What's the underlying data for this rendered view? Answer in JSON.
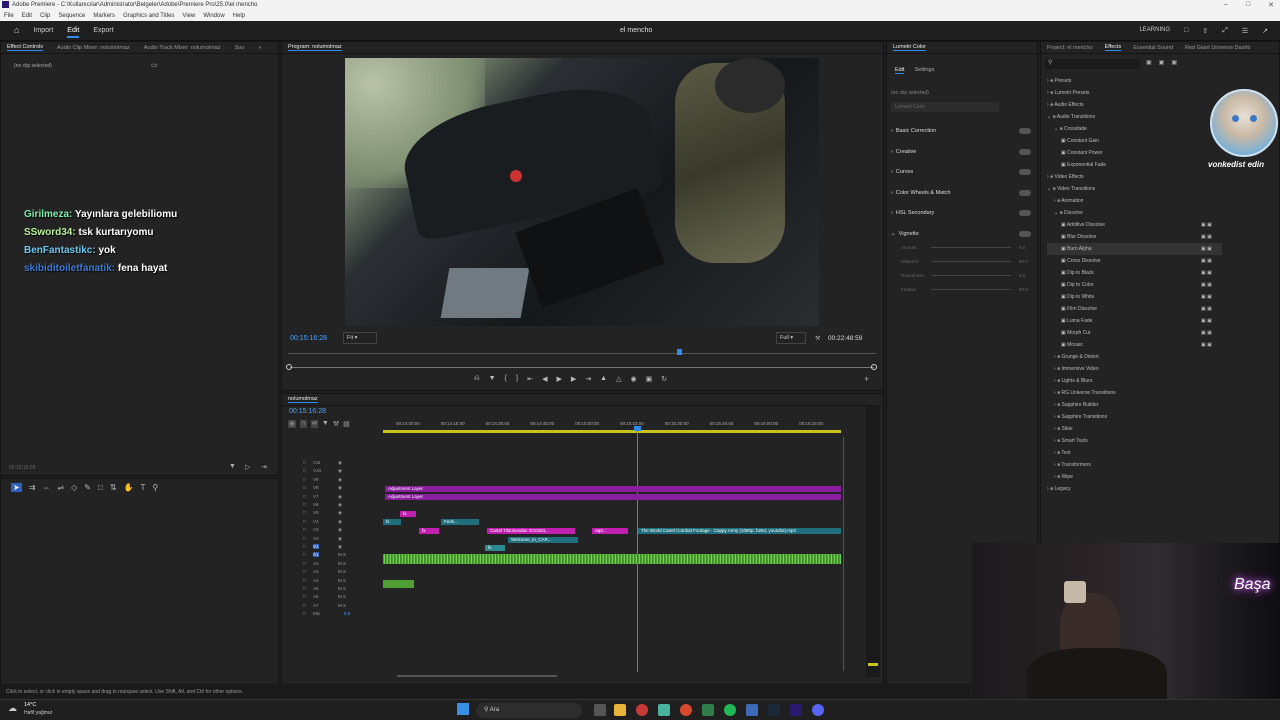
{
  "titlebar": {
    "title": "Adobe Premiere - C:\\Kullanıcılar\\Administrator\\Belgeler\\Adobe\\Premiere Pro\\25.0\\el mencho"
  },
  "menu": [
    "File",
    "Edit",
    "Clip",
    "Sequence",
    "Markers",
    "Graphics and Titles",
    "View",
    "Window",
    "Help"
  ],
  "appbar": {
    "nav": [
      "Import",
      "Edit",
      "Export"
    ],
    "active": "Edit",
    "project_title": "el mencho",
    "learning": "LEARNING"
  },
  "left_panel": {
    "tabs": [
      "Effect Controls",
      "Audio Clip Mixer: nolumolmaz",
      "Audio Track Mixer: nolumolmaz",
      "Sou"
    ],
    "no_clip": "(no clip selected)",
    "timecode": "00:15:16:28"
  },
  "chat": [
    {
      "user": "Girilmeza:",
      "msg": "Yayınlara gelebiliomu"
    },
    {
      "user": "SSword34:",
      "msg": "tsk kurtarıyomu"
    },
    {
      "user": "BenFantastikc:",
      "msg": "yok"
    },
    {
      "user": "skibiditoiletfanatik:",
      "msg": "fena hayat"
    }
  ],
  "program": {
    "tab": "Program: nolumolmaz",
    "timecode": "00:15:16:28",
    "fit": "Fit",
    "full": "Full",
    "duration": "00:22:48:59"
  },
  "lumetri": {
    "title": "Lumetri Color",
    "tabs": [
      "Edit",
      "Settings"
    ],
    "no_clip": "(no clip selected)",
    "dropdown": "Lumetri Color",
    "sections": [
      "Basic Correction",
      "Creative",
      "Curves",
      "Color Wheels & Match",
      "HSL Secondary",
      "Vignette"
    ],
    "vignette_params": [
      "Amount",
      "Midpoint",
      "Roundness",
      "Feather"
    ],
    "param_vals": [
      "0.0",
      "50.0",
      "0.0",
      "50.0"
    ]
  },
  "effects": {
    "tabs": [
      "Project: el mencho",
      "Effects",
      "Essential Sound",
      "Red Giant Universe Dashb"
    ],
    "tree": [
      {
        "label": "Presets",
        "level": 0
      },
      {
        "label": "Lumetri Presets",
        "level": 0
      },
      {
        "label": "Audio Effects",
        "level": 0
      },
      {
        "label": "Audio Transitions",
        "level": 0,
        "open": true
      },
      {
        "label": "Crossfade",
        "level": 1,
        "open": true
      },
      {
        "label": "Constant Gain",
        "level": 2
      },
      {
        "label": "Constant Power",
        "level": 2
      },
      {
        "label": "Exponential Fade",
        "level": 2
      },
      {
        "label": "Video Effects",
        "level": 0
      },
      {
        "label": "Video Transitions",
        "level": 0,
        "open": true
      },
      {
        "label": "Animation",
        "level": 1
      },
      {
        "label": "Dissolve",
        "level": 1,
        "open": true
      },
      {
        "label": "Additive Dissolve",
        "level": 2,
        "badge": true
      },
      {
        "label": "Blur Dissolve",
        "level": 2,
        "badge": true
      },
      {
        "label": "Burn Alpha",
        "level": 2,
        "badge": true
      },
      {
        "label": "Cross Dissolve",
        "level": 2,
        "badge": true
      },
      {
        "label": "Dip to Black",
        "level": 2,
        "badge": true
      },
      {
        "label": "Dip to Color",
        "level": 2,
        "badge": true
      },
      {
        "label": "Dip to White",
        "level": 2,
        "badge": true
      },
      {
        "label": "Film Dissolve",
        "level": 2,
        "badge": true
      },
      {
        "label": "Luma Fade",
        "level": 2,
        "badge": true
      },
      {
        "label": "Morph Cut",
        "level": 2,
        "badge": true
      },
      {
        "label": "Mosaic",
        "level": 2,
        "badge": true
      },
      {
        "label": "Grunge & Distort",
        "level": 1
      },
      {
        "label": "Immersive Video",
        "level": 1
      },
      {
        "label": "Lights & Blurs",
        "level": 1
      },
      {
        "label": "RG Universe Transitions",
        "level": 1
      },
      {
        "label": "Sapphire Builder",
        "level": 1
      },
      {
        "label": "Sapphire Transitions",
        "level": 1
      },
      {
        "label": "Slide",
        "level": 1
      },
      {
        "label": "Smart Tools",
        "level": 1
      },
      {
        "label": "Text",
        "level": 1
      },
      {
        "label": "Transformers",
        "level": 1
      },
      {
        "label": "Wipe",
        "level": 1
      },
      {
        "label": "Legacy",
        "level": 0
      }
    ]
  },
  "overlay": {
    "logo_text": "vonkedist edin"
  },
  "timeline": {
    "tab": "nolumolmaz",
    "timecode": "00:15:16:28",
    "ruler": [
      "00:14:00:00",
      "00:14:15:00",
      "00:14:30:00",
      "00:14:45:00",
      "00:15:00:00",
      "00:15:15:00",
      "00:15:30:00",
      "00:15:45:00",
      "00:16:00:00",
      "00:16:15:00"
    ],
    "tracks": [
      "V11",
      "V10",
      "V9",
      "V8",
      "V7",
      "V6",
      "V5",
      "V4",
      "V3",
      "V2",
      "V1",
      "A1",
      "A2",
      "A3",
      "A4",
      "A5",
      "A6",
      "A7",
      "Mix"
    ],
    "mix_val": "0.0",
    "clips": {
      "adj1": "Adjustment Layer",
      "adj2": "Adjustment Layer",
      "feds": "Feds...",
      "cartel": "Cartel Tiktokundan Görüntü...",
      "rapt": "rapt...",
      "world": "The World Cartel Combat Footage - Cappy Army (1080p, h264, youtube).mp4",
      "welcome": "Welcome_to_CAR...",
      "fx": "fx"
    }
  },
  "status": "Click to select, or click in empty space and drag to marquee select. Use Shift, Alt, and Ctrl for other options.",
  "weather": {
    "temp": "14°C",
    "desc": "Hafif yağmur"
  },
  "search": "Ara",
  "webcam": {
    "neon": "Başa"
  },
  "colors": {
    "accent": "#2d8ceb",
    "adjustment": "#8a1e9e",
    "clip_teal": "#1f6f7e",
    "audio": "#5fbf3f"
  }
}
